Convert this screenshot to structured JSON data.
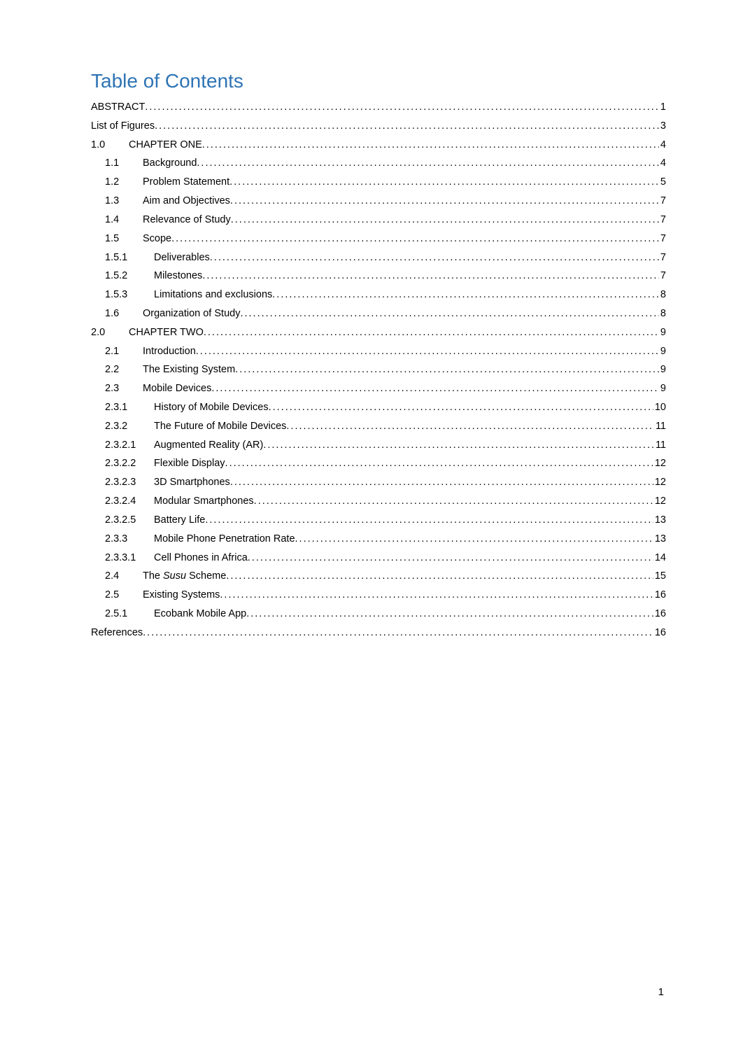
{
  "title": "Table of Contents",
  "pageNumber": "1",
  "entries": [
    {
      "num": "",
      "label": "ABSTRACT",
      "page": "1",
      "indent": 0
    },
    {
      "num": "",
      "label": "List of Figures",
      "page": "3",
      "indent": 0
    },
    {
      "num": "1.0",
      "label": "CHAPTER ONE",
      "page": "4",
      "indent": 1
    },
    {
      "num": "1.1",
      "label": "Background",
      "page": "4",
      "indent": 2
    },
    {
      "num": "1.2",
      "label": "Problem Statement",
      "page": "5",
      "indent": 2
    },
    {
      "num": "1.3",
      "label": "Aim and Objectives",
      "page": "7",
      "indent": 2
    },
    {
      "num": "1.4",
      "label": "Relevance of Study",
      "page": "7",
      "indent": 2
    },
    {
      "num": "1.5",
      "label": "Scope",
      "page": "7",
      "indent": 2
    },
    {
      "num": "1.5.1",
      "label": "Deliverables",
      "page": "7",
      "indent": 3
    },
    {
      "num": "1.5.2",
      "label": "Milestones",
      "page": "7",
      "indent": 3
    },
    {
      "num": "1.5.3",
      "label": "Limitations and exclusions",
      "page": "8",
      "indent": 3
    },
    {
      "num": "1.6",
      "label": "Organization of Study",
      "page": "8",
      "indent": 2
    },
    {
      "num": "2.0",
      "label": "CHAPTER TWO",
      "page": "9",
      "indent": 1
    },
    {
      "num": "2.1",
      "label": "Introduction",
      "page": "9",
      "indent": 2
    },
    {
      "num": "2.2",
      "label": "The Existing System",
      "page": "9",
      "indent": 2
    },
    {
      "num": "2.3",
      "label": "Mobile Devices",
      "page": "9",
      "indent": 2
    },
    {
      "num": "2.3.1",
      "label": "History of Mobile Devices",
      "page": "10",
      "indent": 3
    },
    {
      "num": "2.3.2",
      "label": "The Future of Mobile Devices",
      "page": "11",
      "indent": 3
    },
    {
      "num": "2.3.2.1",
      "label": "Augmented Reality (AR)",
      "page": "11",
      "indent": 4
    },
    {
      "num": "2.3.2.2",
      "label": "Flexible Display",
      "page": "12",
      "indent": 4
    },
    {
      "num": "2.3.2.3",
      "label": "3D Smartphones",
      "page": "12",
      "indent": 4
    },
    {
      "num": "2.3.2.4",
      "label": "Modular Smartphones",
      "page": "12",
      "indent": 4
    },
    {
      "num": "2.3.2.5",
      "label": "Battery Life",
      "page": "13",
      "indent": 4
    },
    {
      "num": "2.3.3",
      "label": "Mobile Phone Penetration Rate",
      "page": "13",
      "indent": 3
    },
    {
      "num": "2.3.3.1",
      "label": "Cell Phones in Africa",
      "page": "14",
      "indent": 4
    },
    {
      "num": "2.4",
      "label_html": "The <span class=\"toc-italic\">Susu</span> Scheme",
      "label": "The Susu Scheme",
      "page": "15",
      "indent": 2
    },
    {
      "num": "2.5",
      "label": "Existing Systems",
      "page": "16",
      "indent": 2
    },
    {
      "num": "2.5.1",
      "label": "Ecobank Mobile App",
      "page": "16",
      "indent": 3
    },
    {
      "num": "",
      "label": "References",
      "page": "16",
      "indent": 0
    }
  ]
}
